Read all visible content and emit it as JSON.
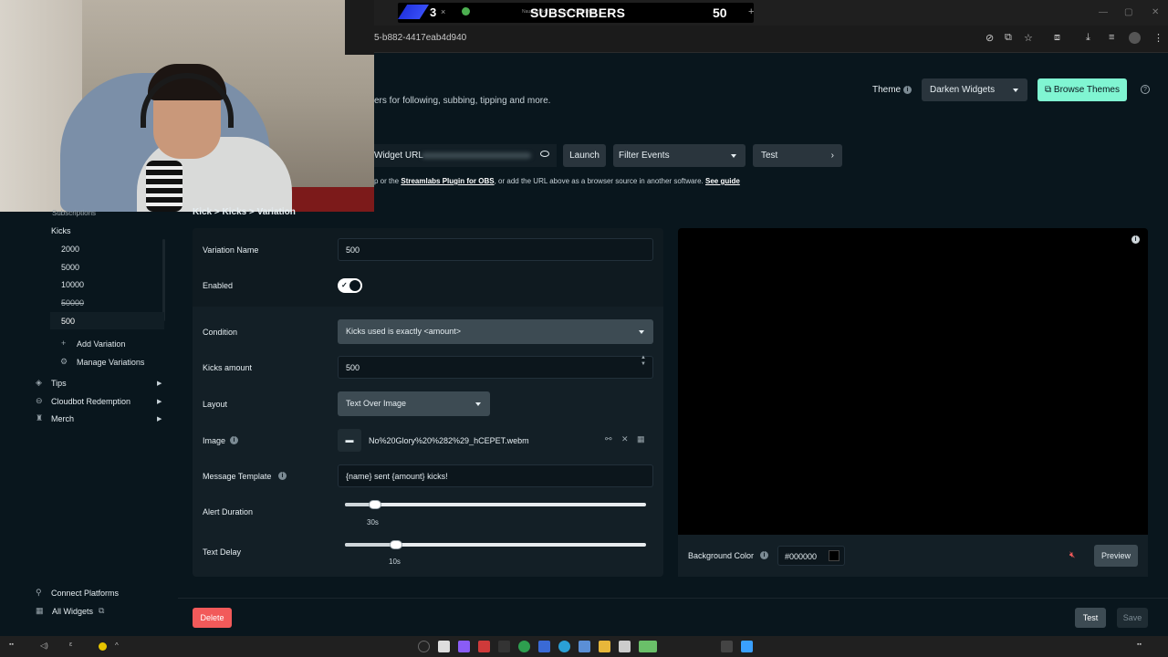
{
  "browser": {
    "tab_number": "3",
    "tab_close": "×",
    "overlay_title": "SUBSCRIBERS",
    "overlay_count": "50",
    "tab_small_text": "Naughty Boy - La la la ft. Sam Smith",
    "new_tab": "+",
    "url_fragment": "5-b882-4417eab4d940"
  },
  "header": {
    "subtitle": "ers for following, subbing, tipping and more.",
    "theme_label": "Theme",
    "theme_value": "Darken Widgets",
    "browse_themes": "Browse Themes"
  },
  "widget_bar": {
    "widget_url_label": "Widget URL",
    "launch": "Launch",
    "filter_events": "Filter Events",
    "test": "Test",
    "guide_prefix": "p or the ",
    "guide_plugin": "Streamlabs Plugin for OBS",
    "guide_mid": ", or add the URL above as a browser source in another software. ",
    "guide_link": "See guide"
  },
  "sidebar": {
    "subscriptions": "Subscriptions",
    "kicks": "Kicks",
    "variations": [
      "2000",
      "5000",
      "10000",
      "50000",
      "500"
    ],
    "add_variation": "Add Variation",
    "manage_variations": "Manage Variations",
    "tips": "Tips",
    "cloudbot": "Cloudbot Redemption",
    "merch": "Merch",
    "connect_platforms": "Connect Platforms",
    "all_widgets": "All Widgets"
  },
  "breadcrumb": "Kick > Kicks > Variation",
  "form": {
    "variation_name_label": "Variation Name",
    "variation_name_value": "500",
    "enabled_label": "Enabled",
    "enabled": true,
    "condition_label": "Condition",
    "condition_value": "Kicks used is exactly <amount>",
    "kicks_amount_label": "Kicks amount",
    "kicks_amount_value": "500",
    "layout_label": "Layout",
    "layout_value": "Text Over Image",
    "image_label": "Image",
    "image_file": "No%20Glory%20%282%29_hCEPET.webm",
    "message_template_label": "Message Template",
    "message_template_value": "{name} sent {amount} kicks!",
    "alert_duration_label": "Alert Duration",
    "alert_duration_value": "30s",
    "alert_duration_fraction": 0.1,
    "text_delay_label": "Text Delay",
    "text_delay_value": "10s",
    "text_delay_fraction": 0.17
  },
  "preview": {
    "background_color_label": "Background Color",
    "background_color_value": "#000000",
    "preview_button": "Preview"
  },
  "footer": {
    "delete": "Delete",
    "test": "Test",
    "save": "Save"
  },
  "colors": {
    "accent": "#80f5d2",
    "danger": "#f25a5a",
    "background": "#09161d"
  }
}
